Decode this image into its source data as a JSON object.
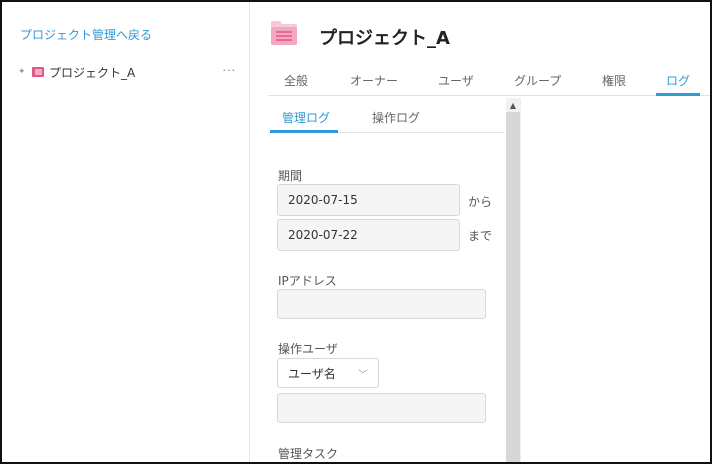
{
  "sidebar": {
    "back_link": "プロジェクト管理へ戻る",
    "tree_item": {
      "label": "プロジェクト_A",
      "more": "···",
      "icon": "folder-list-icon",
      "icon_color": "#e0588a"
    }
  },
  "header": {
    "title": "プロジェクト_A",
    "icon": "project-folder-icon",
    "icon_color": "#e86a92"
  },
  "tabs": [
    {
      "label": "全般"
    },
    {
      "label": "オーナー"
    },
    {
      "label": "ユーザ"
    },
    {
      "label": "グループ"
    },
    {
      "label": "権限"
    },
    {
      "label": "ログ",
      "active": true
    }
  ],
  "subtabs": [
    {
      "label": "管理ログ",
      "active": true
    },
    {
      "label": "操作ログ"
    }
  ],
  "form": {
    "period_label": "期間",
    "from_value": "2020-07-15",
    "from_suffix": "から",
    "to_value": "2020-07-22",
    "to_suffix": "まで",
    "ip_label": "IPアドレス",
    "ip_value": "",
    "user_label": "操作ユーザ",
    "user_select": "ユーザ名",
    "user_value": "",
    "task_label": "管理タスク"
  },
  "accent_color": "#2f9ad6"
}
